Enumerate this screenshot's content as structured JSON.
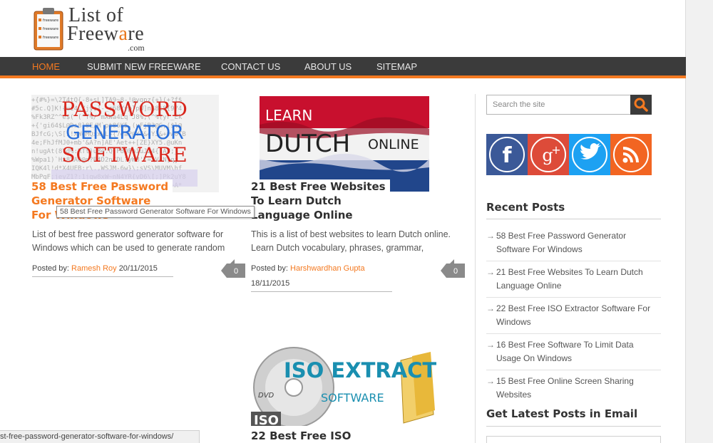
{
  "logo": {
    "line1": "List of",
    "line2_pre": "Freew",
    "line2_accent": "a",
    "line2_post": "re",
    "line3": ".com",
    "clip_items": [
      "freeware",
      "freeware",
      "freeware"
    ]
  },
  "nav": {
    "items": [
      {
        "label": "HOME"
      },
      {
        "label": "SUBMIT NEW FREEWARE"
      },
      {
        "label": "CONTACT US"
      },
      {
        "label": "ABOUT US"
      },
      {
        "label": "SITEMAP"
      }
    ]
  },
  "posts": [
    {
      "image_text": [
        "PASSWORD",
        "GENERATOR",
        "SOFTWARE"
      ],
      "title_lines": [
        "58 Best Free Password",
        "Generator Software",
        "For Windows"
      ],
      "excerpt_lines": [
        "List of best free password generator software for",
        "Windows which can be used to generate random"
      ],
      "posted_by_label": "Posted by:",
      "author": "Ramesh Roy",
      "date": "20/11/2015",
      "comments": "0"
    },
    {
      "image_text": [
        "LEARN",
        "DUTCH",
        "ONLINE"
      ],
      "title_lines": [
        "21 Best Free Websites",
        "To Learn Dutch",
        "Language Online"
      ],
      "excerpt_lines": [
        "This is a list of best websites to learn Dutch online.",
        "Learn Dutch vocabulary, phrases, grammar,"
      ],
      "posted_by_label": "Posted by:",
      "author": "Harshwardhan Gupta",
      "date": "18/11/2015",
      "comments": "0"
    },
    {
      "image_text": [
        "ISO EXTRACT",
        "SOFTWARE",
        "DVD",
        "ISO"
      ],
      "title_lines": [
        "22 Best Free ISO"
      ]
    }
  ],
  "tooltip": "58 Best Free Password Generator Software For Windows",
  "sidebar": {
    "search_placeholder": "Search the site",
    "social": [
      "facebook-icon",
      "google-plus-icon",
      "twitter-icon",
      "rss-icon"
    ],
    "recent_title": "Recent Posts",
    "recent_posts": [
      {
        "line1": "58 Best Free Password Generator",
        "line2": "Software For Windows"
      },
      {
        "line1": "21 Best Free Websites To Learn Dutch",
        "line2": "Language Online"
      },
      {
        "line1": "22 Best Free ISO Extractor Software For",
        "line2": "Windows"
      },
      {
        "line1": "16 Best Free Software To Limit Data",
        "line2": "Usage On Windows"
      },
      {
        "line1": "15 Best Free Online Screen Sharing",
        "line2": "Websites"
      }
    ],
    "email_title": "Get Latest Posts in Email"
  },
  "statusbar": "st-free-password-generator-software-for-windows/",
  "colors": {
    "accent": "#f47920",
    "nav_bg": "#3b3b3b",
    "facebook": "#3b5998",
    "google_plus": "#dd4b39",
    "twitter": "#1da1f2",
    "rss": "#f26522"
  }
}
